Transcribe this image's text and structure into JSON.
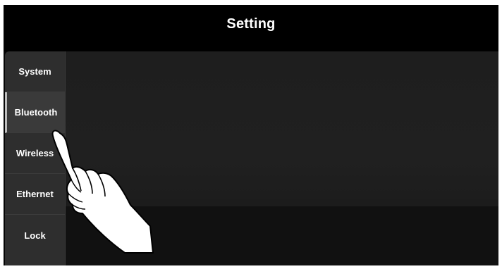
{
  "header": {
    "title": "Setting"
  },
  "sidebar": {
    "items": [
      {
        "label": "System",
        "active": false
      },
      {
        "label": "Bluetooth",
        "active": true
      },
      {
        "label": "Wireless",
        "active": false
      },
      {
        "label": "Ethernet",
        "active": false
      },
      {
        "label": "Lock",
        "active": false
      }
    ]
  },
  "overlay": {
    "icon": "hand-pointer-icon"
  },
  "colors": {
    "background": "#000000",
    "sidebar": "#2e2e2e",
    "content": "#1e1e1e",
    "text": "#ffffff"
  }
}
